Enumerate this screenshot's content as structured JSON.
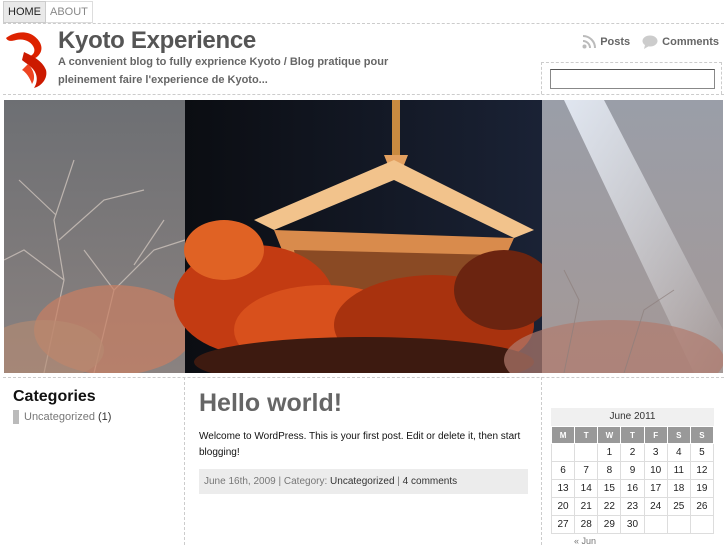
{
  "nav": {
    "items": [
      {
        "label": "HOME"
      },
      {
        "label": "ABOUT"
      }
    ]
  },
  "header": {
    "title": "Kyoto Experience",
    "description": "A convenient blog to fully exprience Kyoto / Blog pratique pour pleinement faire l'experience de Kyoto...",
    "feeds": {
      "posts_label": "Posts",
      "comments_label": "Comments"
    },
    "search": {
      "value": "",
      "placeholder": ""
    }
  },
  "sidebar": {
    "categories_title": "Categories",
    "categories": [
      {
        "label": "Uncategorized",
        "count": "(1)"
      }
    ]
  },
  "post": {
    "title": "Hello world!",
    "body": "Welcome to WordPress. This is your first post. Edit or delete it, then start blogging!",
    "date": "June 16th, 2009",
    "category_prefix": " | Category: ",
    "category": "Uncategorized",
    "separator": " | ",
    "comments": "4 comments"
  },
  "calendar": {
    "caption": "June 2011",
    "weekdays": [
      "M",
      "T",
      "W",
      "T",
      "F",
      "S",
      "S"
    ],
    "weeks": [
      [
        "",
        "",
        "1",
        "2",
        "3",
        "4",
        "5"
      ],
      [
        "6",
        "7",
        "8",
        "9",
        "10",
        "11",
        "12"
      ],
      [
        "13",
        "14",
        "15",
        "16",
        "17",
        "18",
        "19"
      ],
      [
        "20",
        "21",
        "22",
        "23",
        "24",
        "25",
        "26"
      ],
      [
        "27",
        "28",
        "29",
        "30",
        "",
        "",
        ""
      ]
    ],
    "prev_label": "« Jun"
  },
  "colors": {
    "accent": "#dd2200",
    "meta_bg": "#ececec",
    "weekday_bg": "#999999"
  }
}
